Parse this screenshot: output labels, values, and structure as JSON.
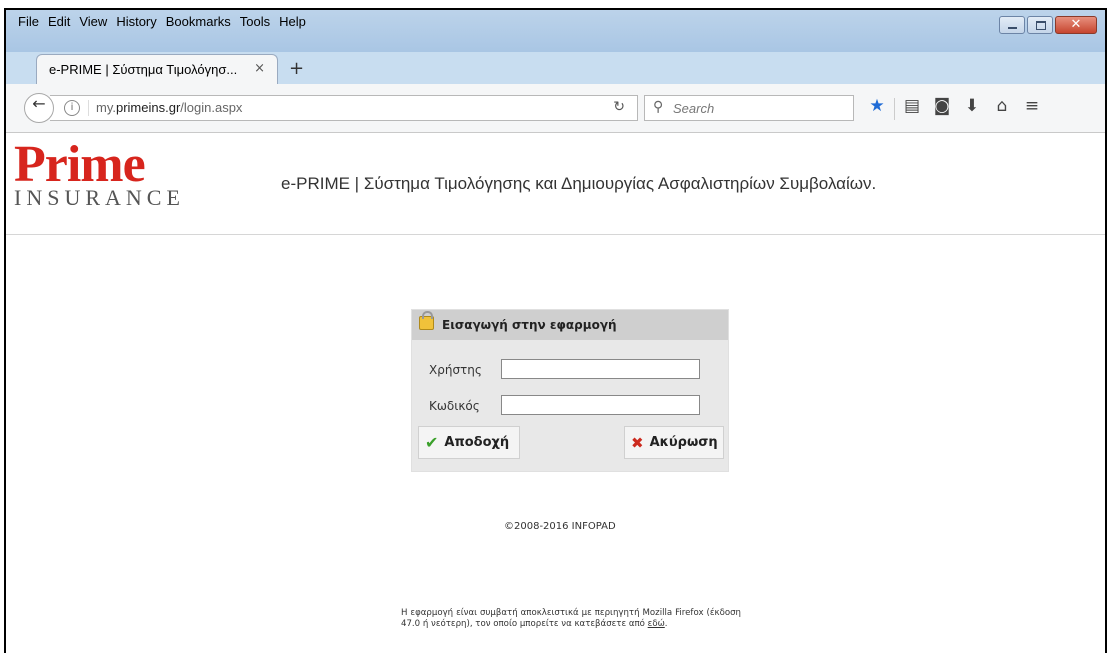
{
  "menu": [
    "File",
    "Edit",
    "View",
    "History",
    "Bookmarks",
    "Tools",
    "Help"
  ],
  "window_controls": {
    "close": "✕"
  },
  "tab": {
    "title": "e-PRIME | Σύστημα Τιμολόγησ...",
    "close": "×",
    "new_tab": "+"
  },
  "address": {
    "domain_prefix": "my.",
    "domain_bold": "primeins.gr",
    "path": "/login.aspx"
  },
  "search": {
    "placeholder": "Search"
  },
  "toolbar_icons": [
    "star-icon",
    "reading-list-icon",
    "pocket-icon",
    "download-icon",
    "home-icon",
    "menu-icon"
  ],
  "logo": {
    "word": "Prime",
    "sub": "INSURANCE"
  },
  "site_title": "e-PRIME | Σύστημα Τιμολόγησης και Δημιουργίας Ασφαλιστηρίων Συμβολαίων.",
  "login": {
    "title": "Εισαγωγή στην εφαρμογή",
    "user_label": "Χρήστης",
    "password_label": "Κωδικός",
    "accept_label": "Αποδοχή",
    "cancel_label": "Ακύρωση"
  },
  "copyright": "©2008-2016 INFOPAD",
  "notice": {
    "text": "Η εφαρμογή είναι συμβατή αποκλειστικά με περιηγητή Mozilla Firefox (έκδοση 47.0 ή νεότερη), τον οποίο μπορείτε να κατεβάσετε από ",
    "link": "εδώ",
    "end": "."
  }
}
